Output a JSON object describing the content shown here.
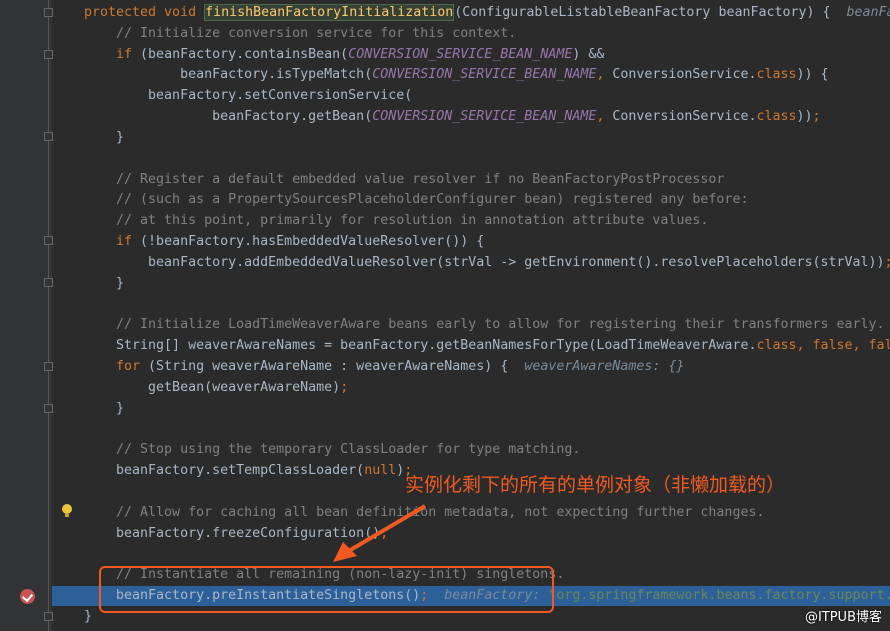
{
  "editor": {
    "lines": [
      [
        [
          "kw",
          "protected void "
        ],
        [
          "fnbox",
          "finishBeanFactoryInitialization"
        ],
        [
          "",
          "(ConfigurableListableBeanFactory beanFactory) {  "
        ],
        [
          "hint",
          "beanFactory"
        ]
      ],
      [
        [
          "cm",
          "    // Initialize conversion service for this context."
        ]
      ],
      [
        [
          "kw",
          "    if "
        ],
        [
          "",
          "(beanFactory.containsBean("
        ],
        [
          "const",
          "CONVERSION_SERVICE_BEAN_NAME"
        ],
        [
          "",
          ") &&"
        ]
      ],
      [
        [
          "",
          "            beanFactory.isTypeMatch("
        ],
        [
          "const",
          "CONVERSION_SERVICE_BEAN_NAME"
        ],
        [
          "kw",
          ", "
        ],
        [
          "",
          "ConversionService."
        ],
        [
          "kw",
          "class"
        ],
        [
          "",
          ")) {"
        ]
      ],
      [
        [
          "",
          "        beanFactory.setConversionService("
        ]
      ],
      [
        [
          "",
          "                beanFactory.getBean("
        ],
        [
          "const",
          "CONVERSION_SERVICE_BEAN_NAME"
        ],
        [
          "kw",
          ", "
        ],
        [
          "",
          "ConversionService."
        ],
        [
          "kw",
          "class"
        ],
        [
          "",
          "))"
        ],
        [
          "kw",
          ";"
        ]
      ],
      [
        [
          "",
          "    }"
        ]
      ],
      [
        [
          "",
          ""
        ]
      ],
      [
        [
          "cm",
          "    // Register a default embedded value resolver if no BeanFactoryPostProcessor"
        ]
      ],
      [
        [
          "cm",
          "    // (such as a PropertySourcesPlaceholderConfigurer bean) registered any before:"
        ]
      ],
      [
        [
          "cm",
          "    // at this point, primarily for resolution in annotation attribute values."
        ]
      ],
      [
        [
          "kw",
          "    if "
        ],
        [
          "",
          "(!beanFactory.hasEmbeddedValueResolver()) {"
        ]
      ],
      [
        [
          "",
          "        beanFactory.addEmbeddedValueResolver(strVal -> getEnvironment().resolvePlaceholders(strVal))"
        ],
        [
          "kw",
          ";"
        ]
      ],
      [
        [
          "",
          "    }"
        ]
      ],
      [
        [
          "",
          ""
        ]
      ],
      [
        [
          "cm",
          "    // Initialize LoadTimeWeaverAware beans early to allow for registering their transformers early."
        ]
      ],
      [
        [
          "",
          "    String[] weaverAwareNames = beanFactory.getBeanNamesForType(LoadTimeWeaverAware."
        ],
        [
          "kw",
          "class, false, false"
        ],
        [
          "",
          ")"
        ],
        [
          "kw",
          ";"
        ]
      ],
      [
        [
          "kw",
          "    for "
        ],
        [
          "",
          "(String weaverAwareName : weaverAwareNames) {  "
        ],
        [
          "hint",
          "weaverAwareNames: {}"
        ]
      ],
      [
        [
          "",
          "        getBean(weaverAwareName)"
        ],
        [
          "kw",
          ";"
        ]
      ],
      [
        [
          "",
          "    }"
        ]
      ],
      [
        [
          "",
          ""
        ]
      ],
      [
        [
          "cm",
          "    // Stop using the temporary ClassLoader for type matching."
        ]
      ],
      [
        [
          "",
          "    beanFactory.setTempClassLoader("
        ],
        [
          "kw",
          "null"
        ],
        [
          "",
          ")"
        ],
        [
          "kw",
          ";"
        ]
      ],
      [
        [
          "",
          ""
        ]
      ],
      [
        [
          "cm",
          "    // Allow for caching all bean definition metadata, not expecting further changes."
        ]
      ],
      [
        [
          "",
          "    beanFactory.freezeConfiguration()"
        ],
        [
          "kw",
          ";"
        ]
      ],
      [
        [
          "",
          ""
        ]
      ],
      [
        [
          "cm",
          "    // Instantiate all remaining (non-lazy-init) singletons."
        ]
      ],
      [
        [
          "",
          "    beanFactory.preInstantiateSingletons()"
        ],
        [
          "kw",
          ";  "
        ],
        [
          "hint",
          "beanFactory: "
        ],
        [
          "str",
          "\"org.springframework.beans.factory.support.Defau"
        ]
      ],
      [
        [
          "",
          "}"
        ]
      ]
    ],
    "highlighted_line": 28,
    "current_line_bg": "#2d6099"
  },
  "annotation": {
    "callout_text": "实例化剩下的所有的单例对象（非懒加载的）",
    "color": "#f05a22"
  },
  "watermark": "@ITPUB博客"
}
